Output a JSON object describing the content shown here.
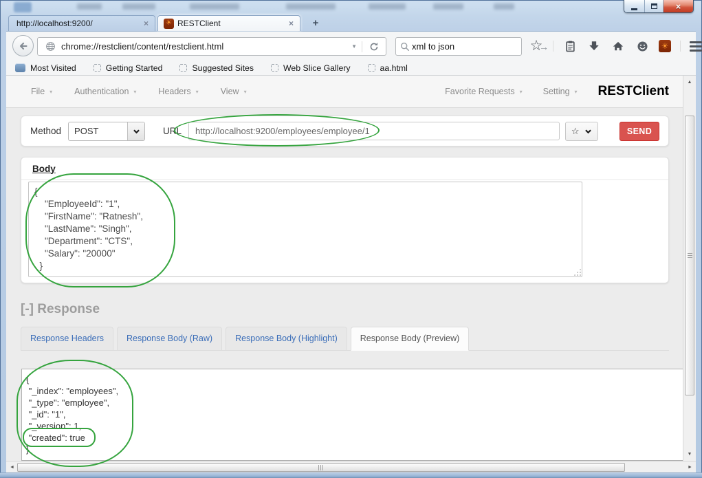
{
  "chrome": {
    "tabs": [
      {
        "title": "http://localhost:9200/"
      },
      {
        "title": "RESTClient"
      }
    ],
    "url": "chrome://restclient/content/restclient.html",
    "search_value": "xml to json",
    "bookmarks": [
      "Most Visited",
      "Getting Started",
      "Suggested Sites",
      "Web Slice Gallery",
      "aa.html"
    ]
  },
  "app": {
    "menu_left": [
      "File",
      "Authentication",
      "Headers",
      "View"
    ],
    "menu_right": [
      "Favorite Requests",
      "Setting"
    ],
    "logo": "RESTClient",
    "request": {
      "method_label": "Method",
      "method_value": "POST",
      "url_label": "URL",
      "url_value": "http://localhost:9200/employees/employee/1",
      "send_label": "SEND"
    },
    "body": {
      "title": "Body",
      "json": "{\n    \"EmployeeId\": \"1\",\n    \"FirstName\": \"Ratnesh\",\n    \"LastName\": \"Singh\",\n    \"Department\": \"CTS\",\n    \"Salary\": \"20000\"\n  }"
    },
    "response": {
      "title": "[-] Response",
      "tabs": [
        "Response Headers",
        "Response Body (Raw)",
        "Response Body (Highlight)",
        "Response Body (Preview)"
      ],
      "active_tab": "Response Body (Preview)",
      "preview_json": "{\n \"_index\": \"employees\",\n \"_type\": \"employee\",\n \"_id\": \"1\",\n \"_version\": 1,\n \"created\": true\n}"
    }
  },
  "icons": {
    "close_x": "×",
    "new_tab": "+",
    "caret_down": "▾",
    "dropdown_small": "▼",
    "star_outline": "☆",
    "home": "⌂",
    "smiley": "☻",
    "sun": "☀",
    "arrow_right": "→",
    "scroll_up": "▲",
    "scroll_down": "▼",
    "scroll_left": "◄",
    "scroll_right": "►"
  },
  "colors": {
    "annotation_green": "#35a43e",
    "send_red": "#d9534f",
    "link_blue": "#3a6db8",
    "chrome_blue": "#bdd0e7"
  }
}
